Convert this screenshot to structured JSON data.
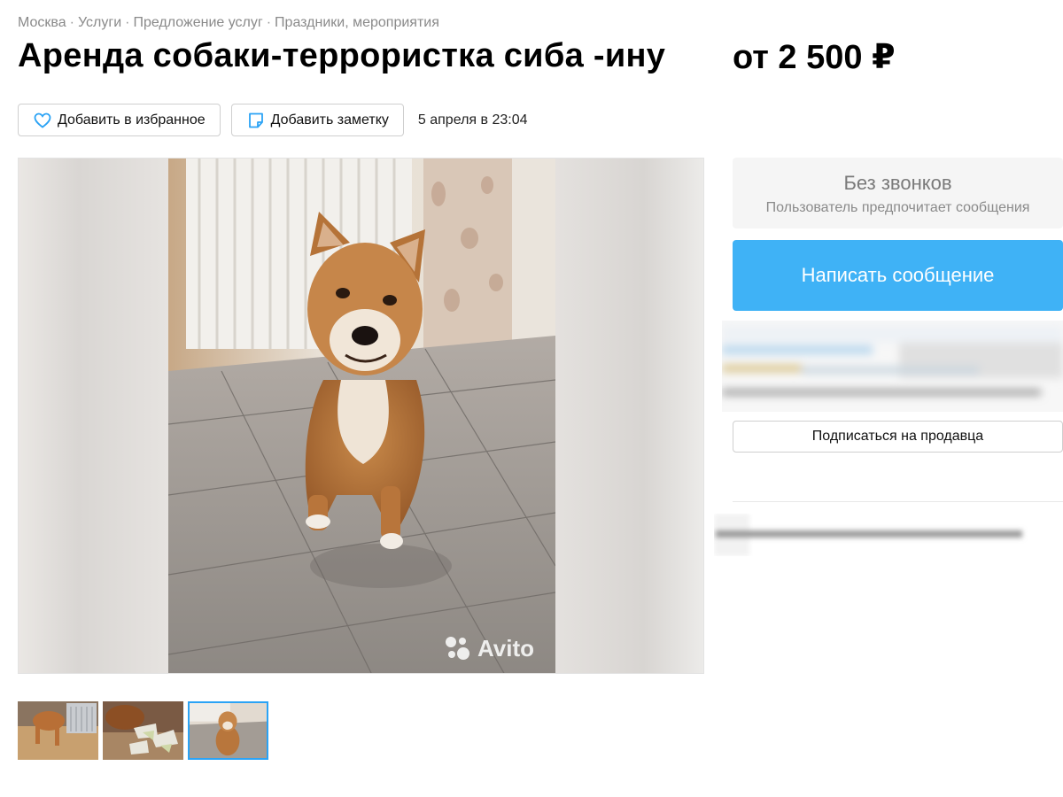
{
  "breadcrumbs": [
    "Москва",
    "Услуги",
    "Предложение услуг",
    "Праздники, мероприятия"
  ],
  "breadcrumb_separator": "·",
  "title": "Аренда собаки-террористка сиба -ину",
  "price": "от 2 500 ₽",
  "actions": {
    "favorite_label": "Добавить в избранное",
    "note_label": "Добавить заметку",
    "date": "5 апреля в 23:04"
  },
  "gallery": {
    "main_image": "shiba-inu-sitting-on-tile-floor",
    "watermark": "Avito",
    "thumbnails": [
      {
        "image": "shiba-inu-near-crate",
        "active": false
      },
      {
        "image": "shiba-inu-with-torn-paper",
        "active": false
      },
      {
        "image": "shiba-inu-sitting-on-tile-floor",
        "active": true
      }
    ]
  },
  "sidebar": {
    "no_calls_title": "Без звонков",
    "no_calls_subtitle": "Пользователь предпочитает сообщения",
    "write_button": "Написать сообщение",
    "subscribe_button": "Подписаться на продавца"
  },
  "icons": {
    "favorite": "heart-icon",
    "note": "sticky-note-icon"
  },
  "colors": {
    "accent": "#3fb2f6",
    "icon_blue": "#2ba3f5",
    "muted_text": "#8a8a8a"
  }
}
